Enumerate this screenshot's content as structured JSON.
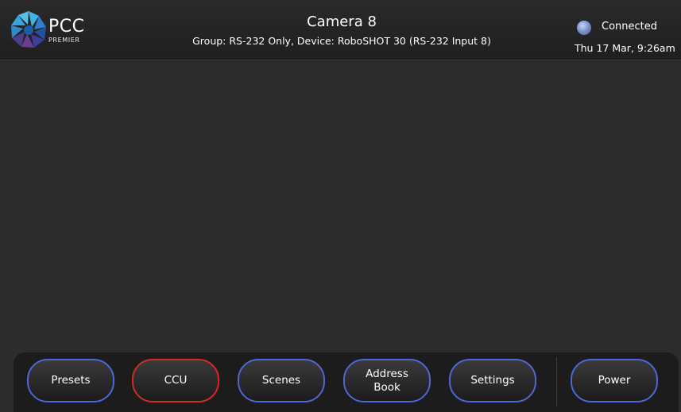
{
  "brand": {
    "name": "PCC",
    "sub": "PREMIER"
  },
  "header": {
    "title": "Camera 8",
    "subtitle": "Group: RS-232 Only,  Device: RoboSHOT 30 (RS-232 Input 8)"
  },
  "status": {
    "text": "Connected",
    "datetime": "Thu 17 Mar, 9:26am",
    "dot_color": "#8a9fd8"
  },
  "nav": {
    "presets": "Presets",
    "ccu": "CCU",
    "scenes": "Scenes",
    "address_book": "Address Book",
    "settings": "Settings",
    "power": "Power",
    "active": "CCU"
  },
  "colors": {
    "button_border": "#4f67d6",
    "active_border": "#d62a26",
    "background": "#2c2c2c"
  }
}
